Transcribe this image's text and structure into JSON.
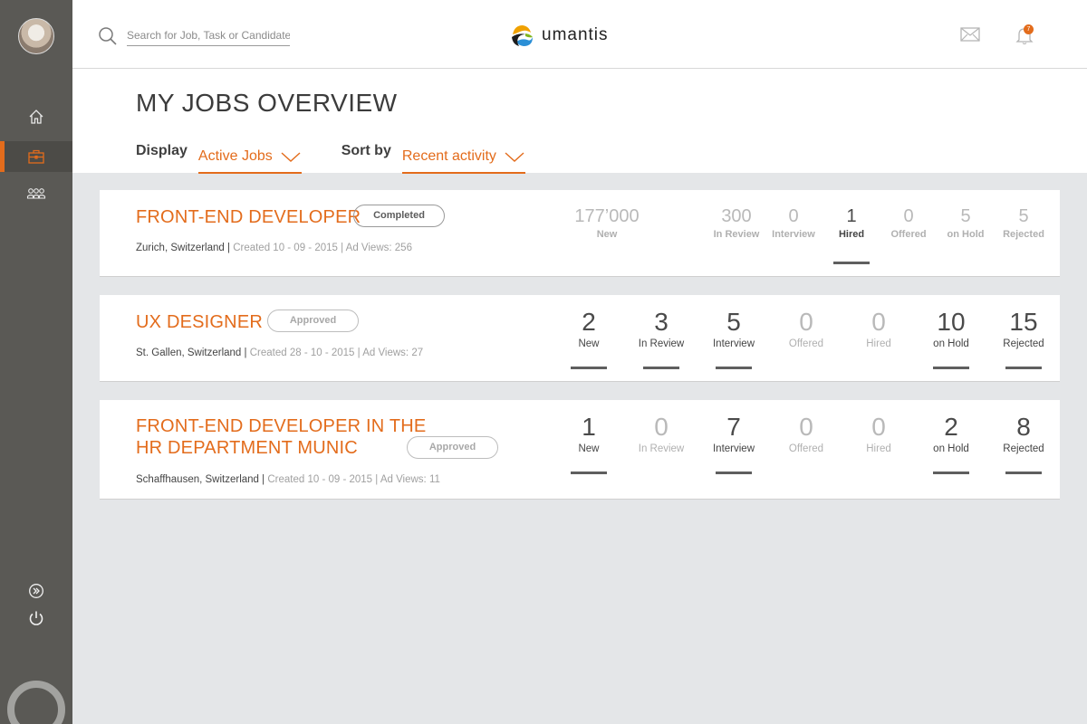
{
  "header": {
    "search_placeholder": "Search for Job, Task or Candidate",
    "brand": "umantis",
    "notification_count": "7"
  },
  "page": {
    "title": "MY JOBS OVERVIEW",
    "display_label": "Display",
    "display_value": "Active Jobs",
    "sort_label": "Sort by",
    "sort_value": "Recent activity"
  },
  "jobs": [
    {
      "title": "FRONT-END DEVELOPER",
      "status": "Completed",
      "location": "Zurich, Switzerland",
      "created": "Created 10 - 09 - 2015",
      "views": "Ad Views: 256",
      "stats": [
        {
          "value": "177’000",
          "label": "New",
          "active": false
        },
        {
          "value": "300",
          "label": "In Review",
          "active": false
        },
        {
          "value": "0",
          "label": "Interview",
          "active": false
        },
        {
          "value": "1",
          "label": "Hired",
          "active": true
        },
        {
          "value": "0",
          "label": "Offered",
          "active": false
        },
        {
          "value": "5",
          "label": "on Hold",
          "active": false
        },
        {
          "value": "5",
          "label": "Rejected",
          "active": false
        }
      ]
    },
    {
      "title": "UX DESIGNER",
      "status": "Approved",
      "location": "St. Gallen, Switzerland",
      "created": "Created 28 - 10 - 2015",
      "views": "Ad Views: 27",
      "stats": [
        {
          "value": "2",
          "label": "New",
          "active": true
        },
        {
          "value": "3",
          "label": "In Review",
          "active": true
        },
        {
          "value": "5",
          "label": "Interview",
          "active": true
        },
        {
          "value": "0",
          "label": "Offered",
          "active": false
        },
        {
          "value": "0",
          "label": "Hired",
          "active": false
        },
        {
          "value": "10",
          "label": "on Hold",
          "active": true
        },
        {
          "value": "15",
          "label": "Rejected",
          "active": true
        }
      ]
    },
    {
      "title_line1": "FRONT-END DEVELOPER IN THE",
      "title_line2": "HR DEPARTMENT MUNIC",
      "status": "Approved",
      "location": "Schaffhausen, Switzerland",
      "created": "Created 10 - 09 - 2015",
      "views": "Ad Views: 11",
      "stats": [
        {
          "value": "1",
          "label": "New",
          "active": true
        },
        {
          "value": "0",
          "label": "In Review",
          "active": false
        },
        {
          "value": "7",
          "label": "Interview",
          "active": true
        },
        {
          "value": "0",
          "label": "Offered",
          "active": false
        },
        {
          "value": "0",
          "label": "Hired",
          "active": false
        },
        {
          "value": "2",
          "label": "on Hold",
          "active": true
        },
        {
          "value": "8",
          "label": "Rejected",
          "active": true
        }
      ]
    }
  ],
  "colors": {
    "accent": "#e36c1c",
    "sidebar": "#5a5955",
    "background": "#e4e6e8"
  },
  "icons": [
    "home-icon",
    "briefcase-icon",
    "people-icon",
    "expand-icon",
    "power-icon",
    "search-icon",
    "mail-icon",
    "bell-icon"
  ]
}
